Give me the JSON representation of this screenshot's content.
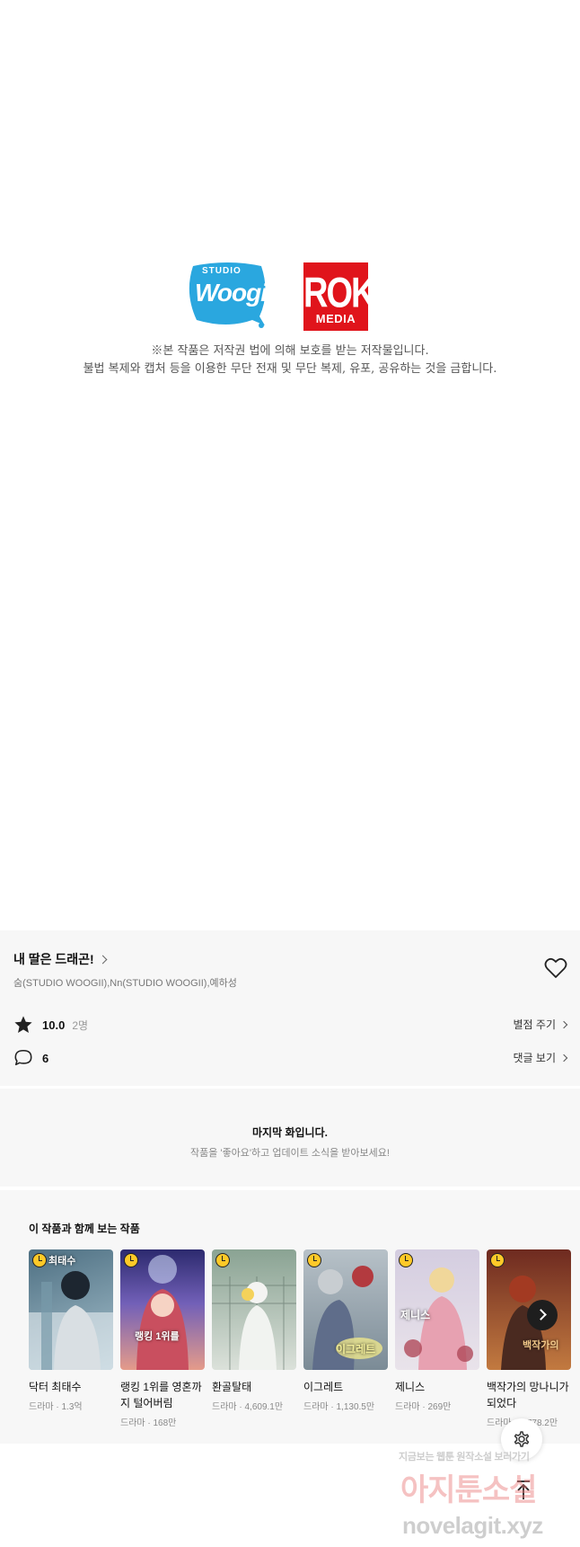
{
  "copyright": {
    "logo_studio_top": "STUDIO",
    "logo_studio_main": "Woogii",
    "logo_rok_main": "ROK",
    "logo_rok_sub": "MEDIA",
    "line1": "※본 작품은 저작권 법에 의해 보호를 받는 저작물입니다.",
    "line2": "불법 복제와 캡처 등을 이용한 무단 전재 및 무단 복제, 유포, 공유하는 것을 금합니다."
  },
  "episode": {
    "title": "내 딸은 드래곤!",
    "authors": "숨(STUDIO WOOGII),Nn(STUDIO WOOGII),예하성",
    "rating": "10.0",
    "rating_count": "2명",
    "rate_link": "별점 주기",
    "comments": "6",
    "comments_link": "댓글 보기"
  },
  "last_episode": {
    "title": "마지막 화입니다.",
    "subtitle": "작품을 '좋아요'하고 업데이트 소식을 받아보세요!"
  },
  "recommendations": {
    "heading": "이 작품과 함께 보는 작품",
    "items": [
      {
        "title": "닥터 최태수",
        "meta": "드라마 · 1.3억",
        "thumb_text": "최태수",
        "thumb_colors": [
          "#5a7f92",
          "#9cb7c4"
        ]
      },
      {
        "title": "랭킹 1위를 영혼까지 털어버림",
        "meta": "드라마 · 168만",
        "thumb_text": "랭킹 1위를",
        "thumb_colors": [
          "#4b3f9a",
          "#e79a8c"
        ]
      },
      {
        "title": "환골탈태",
        "meta": "드라마 · 4,609.1만",
        "thumb_text": "",
        "thumb_colors": [
          "#9fb2a3",
          "#d7ddd6"
        ]
      },
      {
        "title": "이그레트",
        "meta": "드라마 · 1,130.5만",
        "thumb_text": "이그레트",
        "thumb_colors": [
          "#6f7f8a",
          "#c97d7f"
        ]
      },
      {
        "title": "제니스",
        "meta": "드라마 · 269만",
        "thumb_text": "제니스",
        "thumb_colors": [
          "#c9c2d9",
          "#b04a5a"
        ]
      },
      {
        "title": "백작가의 망나니가 되었다",
        "meta": "드라마 · 1,778.2만",
        "thumb_text": "백작가의",
        "thumb_colors": [
          "#7a2b1f",
          "#c9773d"
        ]
      }
    ]
  },
  "watermark": {
    "line1": "지금보는 웹툰 원작소설 보러가기",
    "line2": "아지툰소설",
    "line3": "novelagit.xyz"
  },
  "icons": {
    "heart": "heart-icon",
    "star": "star-icon",
    "comment": "comment-icon",
    "next": "chevron-right-icon",
    "settings": "gear-icon",
    "top": "arrow-up-icon",
    "badge": "clock-icon"
  }
}
